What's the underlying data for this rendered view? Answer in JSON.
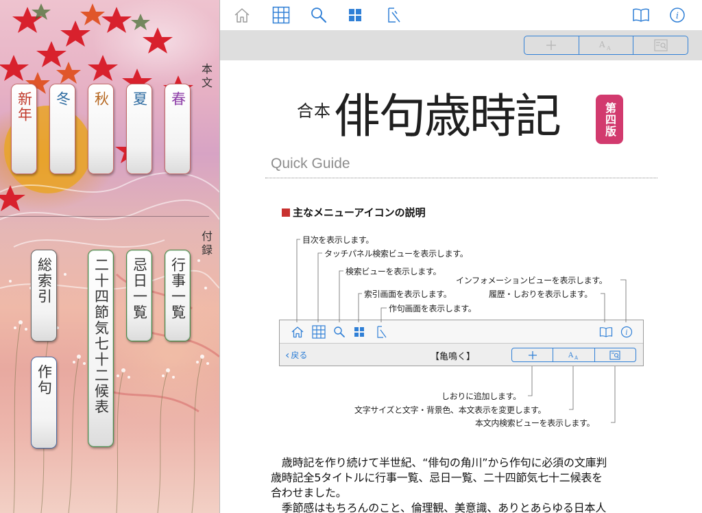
{
  "sidebar": {
    "main_label": "本文",
    "appendix_label": "付録",
    "season_tabs": [
      {
        "label": "新年",
        "color": "#c0392b"
      },
      {
        "label": "冬",
        "color": "#2c6aa0"
      },
      {
        "label": "秋",
        "color": "#b5651d"
      },
      {
        "label": "夏",
        "color": "#2c6aa0"
      },
      {
        "label": "春",
        "color": "#8e3fa8"
      }
    ],
    "appendix_tabs": [
      {
        "label": "総索引"
      },
      {
        "label": "二十四節気七十二候表"
      },
      {
        "label": "忌日一覧"
      },
      {
        "label": "行事一覧"
      },
      {
        "label": "作句"
      }
    ]
  },
  "toolbar": {
    "icons": [
      "home-icon",
      "grid-icon",
      "search-icon",
      "index-icon",
      "compose-icon",
      "book-icon",
      "info-icon"
    ],
    "segment": [
      "add-bookmark-icon",
      "text-size-icon",
      "in-text-search-icon"
    ],
    "accent": "#2f7fd6"
  },
  "content": {
    "brand_small": "合本",
    "brand_big": "俳句歳時記",
    "edition": "第四版",
    "quick_guide": "Quick Guide",
    "section_title": "主なメニューアイコンの説明",
    "annotations": {
      "toc": "目次を表示します。",
      "touch_panel": "タッチパネル検索ビューを表示します。",
      "search": "検索ビューを表示します。",
      "info": "インフォメーションビューを表示します。",
      "index": "索引画面を表示します。",
      "history": "履歴・しおりを表示します。",
      "compose": "作句画面を表示します。",
      "bookmark": "しおりに追加します。",
      "text_size": "文字サイズと文字・背景色、本文表示を変更します。",
      "in_text_search": "本文内検索ビューを表示します。"
    },
    "mock_bar": {
      "back": "戻る",
      "title": "【亀鳴く】"
    },
    "body_lines": [
      "　歳時記を作り続けて半世紀、“俳句の角川”から作句に必須の文庫判",
      "歳時記全5タイトルに行事一覧、忌日一覧、二十四節気七十二候表を",
      "合わせました。",
      "　季節感はもちろんのこと、倫理観、美意識、ありとあらゆる日本人"
    ]
  }
}
